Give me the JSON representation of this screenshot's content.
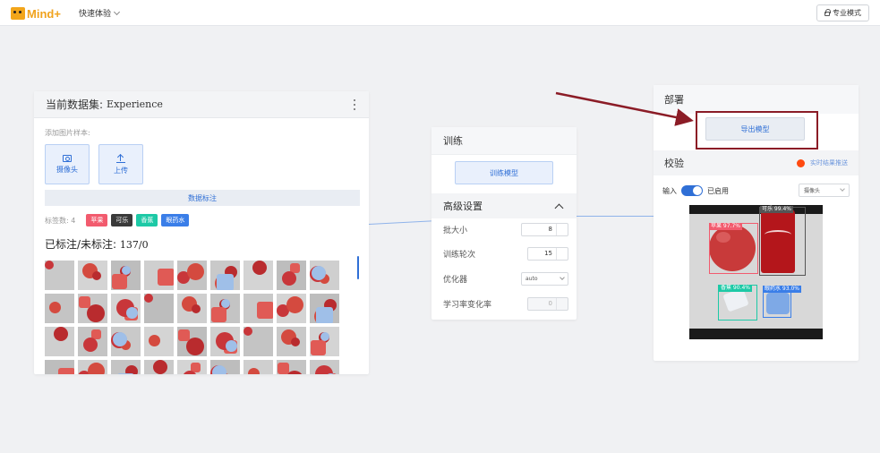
{
  "topbar": {
    "logo_text": "Mind+",
    "quick_mode": "快速体验",
    "pro_mode": "专业模式"
  },
  "dataset": {
    "title": "当前数据集:",
    "dataset_name": "Experience",
    "add_samples_label": "添加图片样本:",
    "camera_button": "摄像头",
    "upload_button": "上传",
    "annotate_button": "数据标注",
    "tag_count_label": "标签数: 4",
    "tags": [
      {
        "label": "苹果",
        "color": "#f25b6e"
      },
      {
        "label": "可乐",
        "color": "#3a3a3a"
      },
      {
        "label": "香蕉",
        "color": "#1dc9a6"
      },
      {
        "label": "眼药水",
        "color": "#3a7ee8"
      }
    ],
    "labeled_label": "已标注/未标注:",
    "labeled_value": "137/0"
  },
  "training": {
    "title": "训练",
    "train_button": "训练模型",
    "advanced_title": "高级设置",
    "params": [
      {
        "label": "批大小",
        "value": "8"
      },
      {
        "label": "训练轮次",
        "value": "15"
      },
      {
        "label": "优化器",
        "value": "auto"
      },
      {
        "label": "学习率变化率",
        "value": "0"
      }
    ]
  },
  "deploy": {
    "title": "部署",
    "export_button": "导出模型",
    "verify_title": "校验",
    "live_push_label": "实时结果推送",
    "input_label": "输入",
    "enabled_label": "已启用",
    "camera_select": "摄像头",
    "detections": [
      {
        "label": "苹果 97.7%",
        "color": "#f25b6e"
      },
      {
        "label": "可乐 99.4%",
        "color": "#555555"
      },
      {
        "label": "香蕉 90.4%",
        "color": "#1dc9a6"
      },
      {
        "label": "眼药水 93.0%",
        "color": "#3a7ee8"
      }
    ]
  },
  "colors": {
    "accent": "#2f6fd6",
    "highlight": "#8b1c26",
    "live_dot": "#ff4a10"
  }
}
